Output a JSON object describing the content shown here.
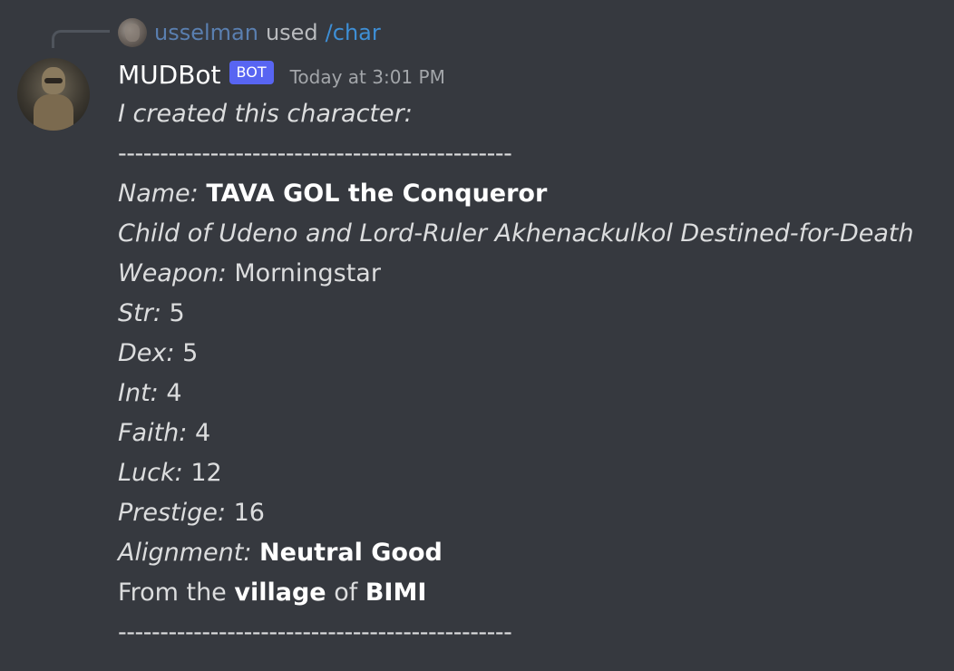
{
  "reply": {
    "username": "usselman",
    "used_text": "used",
    "command": "/char"
  },
  "author": {
    "name": "MUDBot",
    "tag": "BOT",
    "timestamp": "Today at 3:01 PM"
  },
  "message": {
    "intro": "I created this character:",
    "divider": "-----------------------------------------------",
    "name_label": "Name:",
    "name_value": "TAVA GOL the Conqueror",
    "lineage": "Child of Udeno and Lord-Ruler Akhenackulkol Destined-for-Death",
    "weapon_label": "Weapon:",
    "weapon_value": "Morningstar",
    "stats": [
      {
        "label": "Str:",
        "value": "5"
      },
      {
        "label": "Dex:",
        "value": "5"
      },
      {
        "label": "Int:",
        "value": "4"
      },
      {
        "label": "Faith:",
        "value": "4"
      },
      {
        "label": "Luck:",
        "value": "12"
      },
      {
        "label": "Prestige:",
        "value": "16"
      }
    ],
    "alignment_label": "Alignment:",
    "alignment_value": "Neutral Good",
    "origin_prefix": "From the",
    "origin_place_type": "village",
    "origin_of": "of",
    "origin_name": "BIMI",
    "divider_end": "-----------------------------------------------"
  },
  "colors": {
    "background": "#36393f",
    "text": "#dcddde",
    "username": "#ffffff",
    "bot_tag": "#5865f2",
    "reply_user": "#5a7fb0",
    "command": "#3e8fd6",
    "timestamp": "#a3a6aa"
  },
  "icons": {
    "reply_avatar": "user-avatar-icon",
    "bot_avatar": "bot-avatar-icon"
  }
}
